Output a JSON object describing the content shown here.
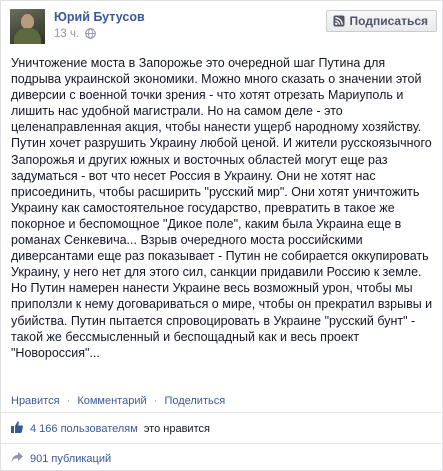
{
  "post": {
    "author": "Юрий Бутусов",
    "time": "13 ч.",
    "subscribe_label": "Подписаться",
    "paragraph": "Уничтожение моста в Запорожье это очередной шаг Путина для подрыва украинской экономики. Можно много сказать о значении этой диверсии с военной точки зрения - что хотят отрезать Мариуполь и лишить нас удобной магистрали. Но на самом деле - это целенаправленная акция, чтобы нанести ущерб народному хозяйству. Путин хочет разрушить Украину любой ценой. И жители русскоязычного Запорожья и других южных и восточных областей могут еще раз задуматься - вот что несет Россия в Украину. Они не хотят нас присоединить, чтобы расширить \"русский мир\". Они хотят уничтожить Украину как самостоятельное государство, превратить в такое же покорное и беспомощное \"Дикое поле\", каким была Украина еще в романах Сенкевича... Взрыв очередного моста российскими диверсантами еще раз показывает - Путин не собирается оккупировать Украину, у него нет для этого сил, санкции придавили Россию к земле. Но Путин намерен нанести Украине весь возможный урон, чтобы мы приползли к нему договариваться о мире, чтобы он прекратил взрывы и убийства. Путин пытается спровоцировать в Украине \"русский бунт\" - такой же бессмысленный и беспощадный как и весь проект \"Новороссия\"..."
  },
  "actions": {
    "like": "Нравится",
    "comment": "Комментарий",
    "share": "Поделиться",
    "separator": "·"
  },
  "stats": {
    "likes_count": "4 166 пользователям",
    "likes_suffix": "это нравится",
    "shares_count": "901 публикаций"
  },
  "icons": {
    "globe": "globe-icon",
    "subscribe": "rss-subscribe-icon",
    "like": "thumbs-up-icon",
    "share": "share-icon"
  },
  "colors": {
    "link": "#3b5998",
    "meta": "#9197a3",
    "text": "#141823"
  }
}
